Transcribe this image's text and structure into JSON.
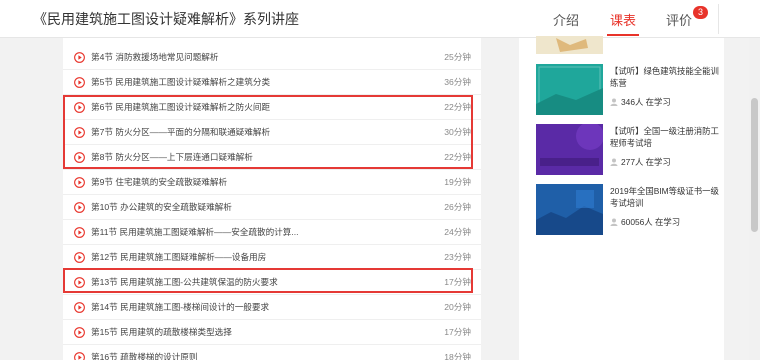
{
  "header": {
    "course_title": "《民用建筑施工图设计疑难解析》系列讲座",
    "tabs": [
      {
        "label": "介绍",
        "active": false
      },
      {
        "label": "课表",
        "active": true
      },
      {
        "label": "评价",
        "active": false,
        "badge": "3"
      }
    ]
  },
  "colors": {
    "accent": "#e8332a",
    "highlight_border": "#e53935"
  },
  "lessons": [
    {
      "title": "第4节  消防救援场地常见问题解析",
      "duration": "25分钟",
      "highlighted": false
    },
    {
      "title": "第5节  民用建筑施工图设计疑难解析之建筑分类",
      "duration": "36分钟",
      "highlighted": false
    },
    {
      "title": "第6节  民用建筑施工图设计疑难解析之防火间距",
      "duration": "22分钟",
      "highlighted": true
    },
    {
      "title": "第7节  防火分区——平面的分隔和联通疑难解析",
      "duration": "30分钟",
      "highlighted": true
    },
    {
      "title": "第8节  防火分区——上下层连通口疑难解析",
      "duration": "22分钟",
      "highlighted": true
    },
    {
      "title": "第9节  住宅建筑的安全疏散疑难解析",
      "duration": "19分钟",
      "highlighted": false
    },
    {
      "title": "第10节  办公建筑的安全疏散疑难解析",
      "duration": "26分钟",
      "highlighted": false
    },
    {
      "title": "第11节  民用建筑施工图疑难解析——安全疏散的计算...",
      "duration": "24分钟",
      "highlighted": false
    },
    {
      "title": "第12节  民用建筑施工图疑难解析——设备用房",
      "duration": "23分钟",
      "highlighted": false
    },
    {
      "title": "第13节  民用建筑施工图-公共建筑保温的防火要求",
      "duration": "17分钟",
      "highlighted": true
    },
    {
      "title": "第14节  民用建筑施工图-楼梯间设计的一般要求",
      "duration": "20分钟",
      "highlighted": false
    },
    {
      "title": "第15节  民用建筑的疏散楼梯类型选择",
      "duration": "17分钟",
      "highlighted": false
    },
    {
      "title": "第16节  疏散楼梯的设计原则",
      "duration": "18分钟",
      "highlighted": false
    }
  ],
  "recommendations": [
    {
      "title": "【试听】绿色建筑技能全能训练营",
      "learners": "346人 在学习",
      "thumb_caption": "绿色建筑技能全能训练营",
      "thumb_color": "#1fa79b"
    },
    {
      "title": "【试听】全国一级注册消防工程师考试培",
      "learners": "277人 在学习",
      "thumb_caption": "全国一级注册消防工程师考试培训",
      "thumb_color": "#5a2aa6"
    },
    {
      "title": "2019年全国BIM等级证书一级考试培训",
      "learners": "60056人 在学习",
      "thumb_caption": "2019年全国BIM等级考试（一级）考试培训",
      "thumb_color": "#1f5fa8"
    }
  ]
}
